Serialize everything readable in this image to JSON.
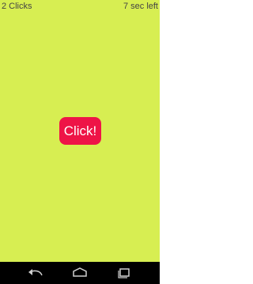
{
  "game": {
    "clicks_text": "2 Clicks",
    "time_left_text": "7 sec left",
    "button_label": "Click!",
    "background_color": "#d7ee52",
    "button_color": "#ee1447"
  },
  "system_nav": {
    "back_icon": "back-icon",
    "home_icon": "home-icon",
    "recents_icon": "recents-icon"
  }
}
